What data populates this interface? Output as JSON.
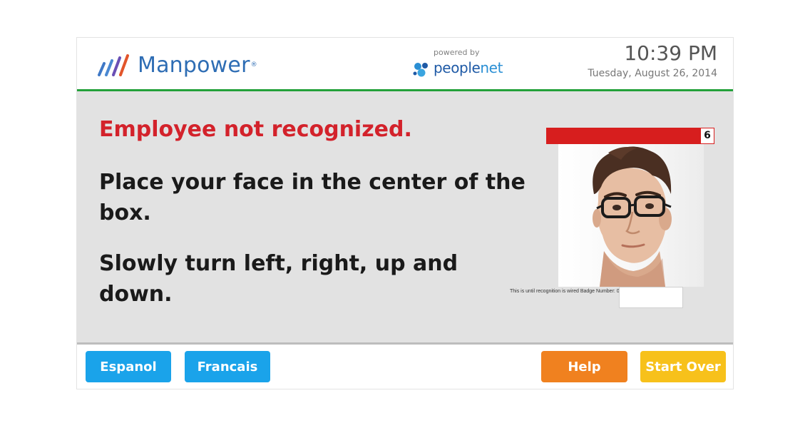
{
  "header": {
    "brand_name": "Manpower",
    "brand_reg": "®",
    "powered_by": "powered by",
    "partner_name_a": "people",
    "partner_name_b": "net",
    "time": "10:39 PM",
    "date": "Tuesday, August 26, 2014"
  },
  "main": {
    "error_message": "Employee not recognized.",
    "instruction_1": "Place your face in the center of the box.",
    "instruction_2": "Slowly turn left, right, up and down.",
    "attempt_counter": "6",
    "badge_note": "This is until recognition is wired Badge Number: 0"
  },
  "footer": {
    "espanol_label": "Espanol",
    "francais_label": "Francais",
    "help_label": "Help",
    "start_over_label": "Start Over"
  },
  "colors": {
    "header_rule": "#23a13a",
    "error_text": "#d3222b",
    "language_button": "#1aa3ea",
    "help_button": "#f0811f",
    "start_over_button": "#f7c11b",
    "counter_bar": "#d71e1e"
  },
  "icons": {
    "brand_logo": "manpower-logo-icon",
    "partner_logo": "peoplenet-logo-icon",
    "camera_preview": "face-photo"
  }
}
